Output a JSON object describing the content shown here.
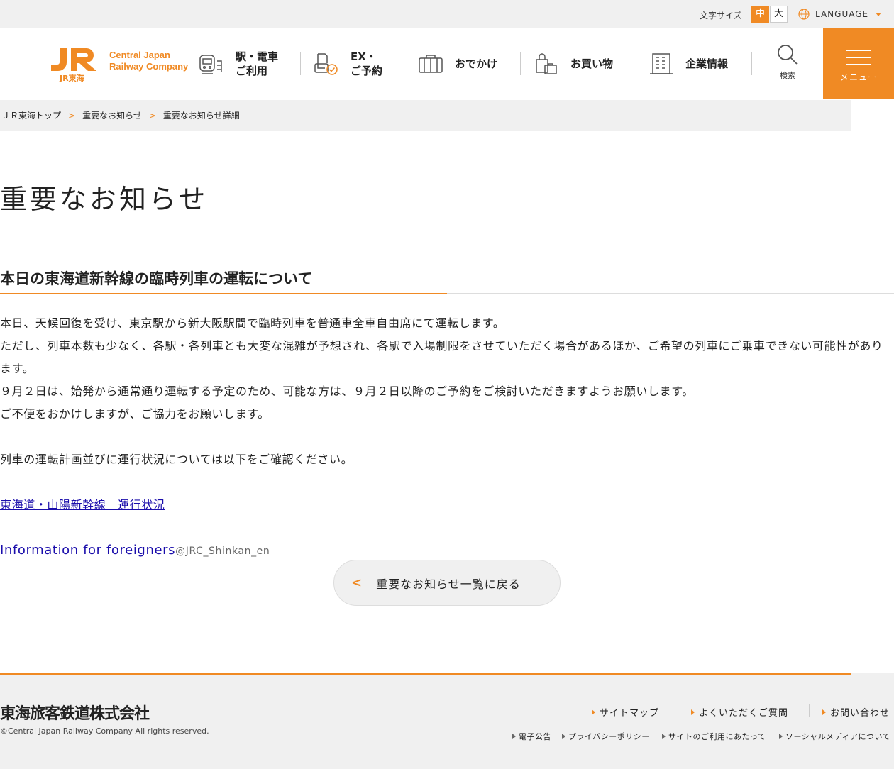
{
  "topbar": {
    "font_size_label": "文字サイズ",
    "font_size_mid": "中",
    "font_size_big": "大",
    "language": "LANGUAGE"
  },
  "header": {
    "logo_line1": "Central Japan",
    "logo_line2": "Railway Company",
    "logo_sub": "JR東海",
    "nav": [
      {
        "line1": "駅・電車",
        "line2": "ご利用",
        "icon": "train-icon"
      },
      {
        "line1": "EX・",
        "line2": "ご予約",
        "icon": "reservation-icon"
      },
      {
        "line1": "おでかけ",
        "line2": "",
        "icon": "suitcase-icon"
      },
      {
        "line1": "お買い物",
        "line2": "",
        "icon": "shopping-bag-icon"
      },
      {
        "line1": "企業情報",
        "line2": "",
        "icon": "building-icon"
      }
    ],
    "search_label": "検索",
    "menu_label": "メニュー"
  },
  "breadcrumb": [
    "ＪＲ東海トップ",
    "重要なお知らせ",
    "重要なお知らせ詳細"
  ],
  "page_title": "重要なお知らせ",
  "article": {
    "title": "本日の東海道新幹線の臨時列車の運転について",
    "paragraphs": [
      "本日、天候回復を受け、東京駅から新大阪駅間で臨時列車を普通車全車自由席にて運転します。",
      "ただし、列車本数も少なく、各駅・各列車とも大変な混雑が予想され、各駅で入場制限をさせていただく場合があるほか、ご希望の列車にご乗車できない可能性があります。",
      "９月２日は、始発から通常通り運転する予定のため、可能な方は、９月２日以降のご予約をご検討いただきますようお願いします。",
      "ご不便をおかけしますが、ご協力をお願いします。"
    ],
    "confirm_text": "列車の運転計画並びに運行状況については以下をご確認ください。",
    "link_status": "東海道・山陽新幹線　運行状況",
    "link_foreigners": "Information for foreigners",
    "handle": "@JRC_Shinkan_en"
  },
  "back_button": "重要なお知らせ一覧に戻る",
  "footer": {
    "corp_name": "東海旅客鉄道株式会社",
    "copyright": "©Central Japan Railway Company All rights reserved.",
    "nav_primary": [
      "サイトマップ",
      "よくいただくご質問",
      "お問い合わせ"
    ],
    "nav_secondary": [
      "電子公告",
      "プライバシーポリシー",
      "サイトのご利用にあたって",
      "ソーシャルメディアについて"
    ]
  },
  "colors": {
    "accent": "#f08a24",
    "link": "#1a0dab",
    "gray_bg": "#f0f0f0"
  }
}
